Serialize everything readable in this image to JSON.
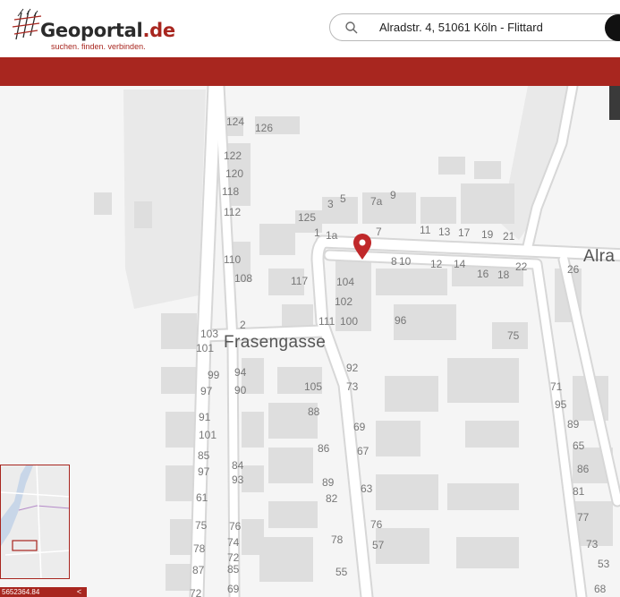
{
  "logo": {
    "wordmark": "Geoportal",
    "tld": ".de",
    "tagline": "suchen. finden. verbinden."
  },
  "search": {
    "value": "Alradstr. 4, 51061 Köln - Flittard",
    "icon": "search-icon"
  },
  "colors": {
    "brand": "#a8261f",
    "road": "#ffffff",
    "building": "#dedede",
    "map_background": "#f5f5f5",
    "marker": "#c0282a"
  },
  "map": {
    "streets": [
      "Frasengasse",
      "Alra"
    ],
    "house_numbers": [
      "124",
      "126",
      "122",
      "120",
      "118",
      "112",
      "125",
      "3",
      "5",
      "7a",
      "9",
      "1",
      "1a",
      "7",
      "11",
      "13",
      "17",
      "19",
      "21",
      "110",
      "108",
      "117",
      "8",
      "10",
      "12",
      "14",
      "16",
      "18",
      "22",
      "26",
      "104",
      "102",
      "111",
      "100",
      "96",
      "75",
      "2",
      "103",
      "101",
      "99",
      "97",
      "94",
      "90",
      "105",
      "92",
      "73",
      "71",
      "95",
      "91",
      "101",
      "88",
      "69",
      "89",
      "85",
      "97",
      "86",
      "67",
      "65",
      "86",
      "84",
      "93",
      "89",
      "82",
      "63",
      "81",
      "61",
      "77",
      "75",
      "78",
      "76",
      "74",
      "72",
      "85",
      "78",
      "76",
      "57",
      "73",
      "87",
      "55",
      "53",
      "68",
      "69",
      "72"
    ]
  },
  "coordinate_readout": "5652364.84",
  "collapse_label": "<"
}
